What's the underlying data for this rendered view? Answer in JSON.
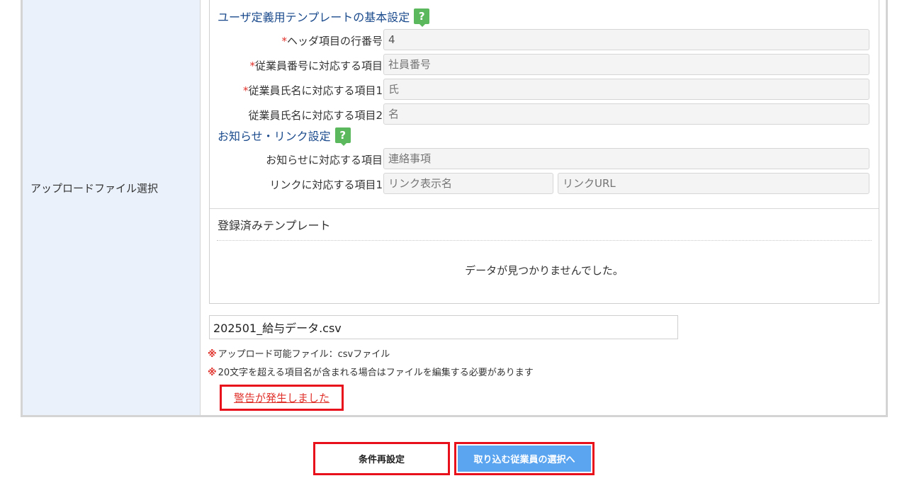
{
  "sidebar_label": "アップロードファイル選択",
  "template_section": {
    "title": "ユーザ定義用テンプレートの基本設定",
    "help_glyph": "?",
    "fields": [
      {
        "label": "ヘッダ項目の行番号",
        "required": true,
        "value": "4",
        "placeholder": ""
      },
      {
        "label": "従業員番号に対応する項目",
        "required": true,
        "value": "",
        "placeholder": "社員番号"
      },
      {
        "label": "従業員氏名に対応する項目1",
        "required": true,
        "value": "",
        "placeholder": "氏"
      },
      {
        "label": "従業員氏名に対応する項目2",
        "required": false,
        "value": "",
        "placeholder": "名"
      }
    ]
  },
  "notice_section": {
    "title": "お知らせ・リンク設定",
    "help_glyph": "?",
    "notice_label": "お知らせに対応する項目",
    "notice_placeholder": "連絡事項",
    "link_label": "リンクに対応する項目1",
    "link_name_placeholder": "リンク表示名",
    "link_url_placeholder": "リンクURL"
  },
  "registered": {
    "title": "登録済みテンプレート",
    "empty_message": "データが見つかりませんでした。"
  },
  "file": {
    "value": "202501_給与データ.csv"
  },
  "notes": {
    "mark": "※",
    "allowed": "アップロード可能ファイル：csvファイル",
    "length_warning": "20文字を超える項目名が含まれる場合はファイルを編集する必要があります"
  },
  "warning_link": "警告が発生しました",
  "buttons": {
    "reset": "条件再設定",
    "next": "取り込む従業員の選択へ"
  },
  "colors": {
    "accent_blue": "#5ba5f0",
    "title_blue": "#1a4a8c",
    "help_green": "#5cb85c",
    "alert_red": "#e8101a",
    "label_bg": "#eaf1fb"
  }
}
